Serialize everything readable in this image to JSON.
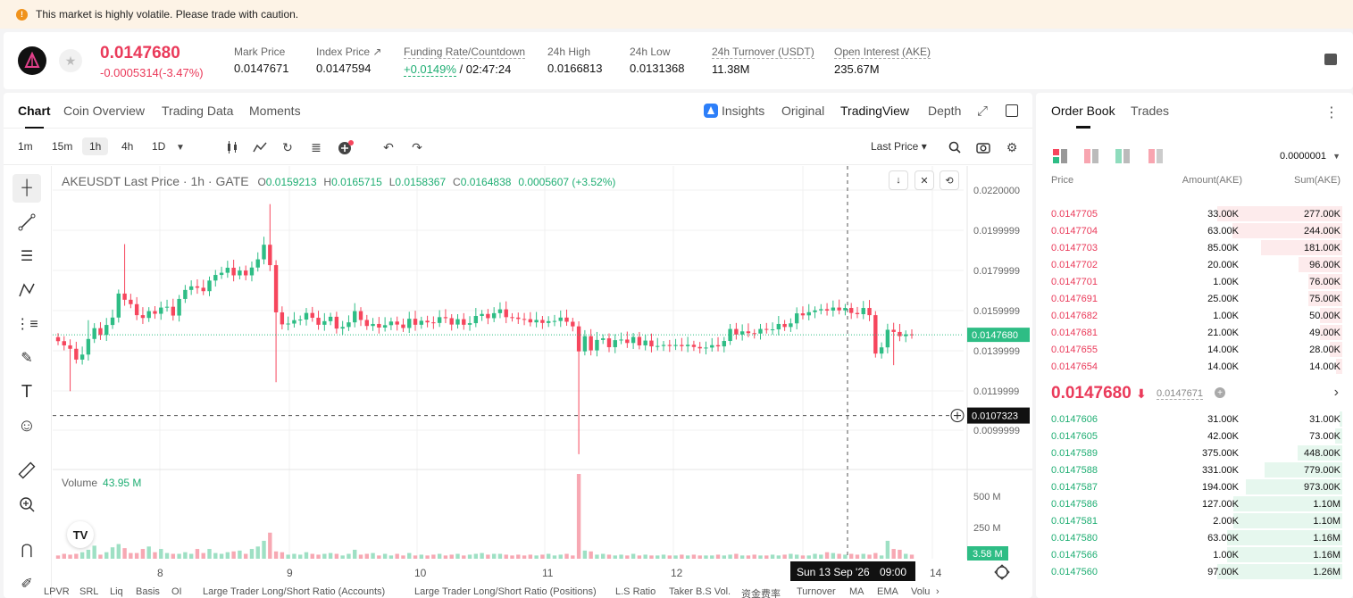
{
  "banner": {
    "text": "This market is highly volatile. Please trade with caution."
  },
  "ticker": {
    "last_price": "0.0147680",
    "change": "-0.0005314(-3.47%)",
    "stats": [
      {
        "label": "Mark Price",
        "value": "0.0147671"
      },
      {
        "label": "Index Price ↗",
        "value": "0.0147594"
      },
      {
        "label": "Funding Rate/Countdown",
        "value_rate": "+0.0149%",
        "value_countdown": " / 02:47:24"
      },
      {
        "label": "24h High",
        "value": "0.0166813"
      },
      {
        "label": "24h Low",
        "value": "0.0131368"
      },
      {
        "label": "24h Turnover (USDT)",
        "value": "11.38M"
      },
      {
        "label": "Open Interest (AKE)",
        "value": "235.67M"
      }
    ]
  },
  "tabs": [
    "Chart",
    "Coin Overview",
    "Trading Data",
    "Moments"
  ],
  "view_tabs": [
    "Insights",
    "Original",
    "TradingView",
    "Depth"
  ],
  "toolbar": {
    "intervals": [
      "1m",
      "15m",
      "1h",
      "4h",
      "1D"
    ],
    "price_type": "Last Price ▾"
  },
  "legend": {
    "symbol": "AKEUSDT Last Price · 1h · GATE",
    "open_label": "O",
    "open": "0.0159213",
    "high_label": "H",
    "high": "0.0165715",
    "low_label": "L",
    "low": "0.0158367",
    "close_label": "C",
    "close": "0.0164838",
    "change": "0.0005607 (+3.52%)"
  },
  "volume": {
    "label": "Volume",
    "value": "43.95 M"
  },
  "chart_data": {
    "type": "candlestick",
    "symbol": "AKEUSDT",
    "interval": "1h",
    "y_ticks": [
      "0.0220000",
      "0.0199999",
      "0.0179999",
      "0.0159999",
      "0.0139999",
      "0.0119999",
      "0.0099999"
    ],
    "vol_ticks": [
      "500 M",
      "250 M"
    ],
    "x_ticks": [
      "8",
      "9",
      "10",
      "11",
      "12",
      "14"
    ],
    "current_price": "0.0147680",
    "crosshair_price": "0.0107323",
    "current_volume": "3.58 M",
    "crosshair_time": "Sun 13 Sep '26",
    "crosshair_hour": "09:00",
    "closes": [
      0.01445,
      0.01424,
      0.01407,
      0.01353,
      0.01378,
      0.01456,
      0.0151,
      0.01476,
      0.01526,
      0.01563,
      0.01683,
      0.01652,
      0.0163,
      0.01575,
      0.01561,
      0.01595,
      0.01582,
      0.01613,
      0.01617,
      0.01573,
      0.01656,
      0.01701,
      0.01719,
      0.01712,
      0.01695,
      0.01748,
      0.01776,
      0.01787,
      0.01812,
      0.01774,
      0.01798,
      0.01774,
      0.01813,
      0.01854,
      0.01927,
      0.01825,
      0.01589,
      0.01529,
      0.01533,
      0.0155,
      0.01553,
      0.01586,
      0.01562,
      0.01527,
      0.01545,
      0.01567,
      0.01508,
      0.01516,
      0.01539,
      0.01595,
      0.01551,
      0.01521,
      0.01531,
      0.01513,
      0.01525,
      0.01543,
      0.01528,
      0.01511,
      0.01557,
      0.01527,
      0.01547,
      0.01539,
      0.01536,
      0.01565,
      0.0156,
      0.01528,
      0.01555,
      0.01527,
      0.01535,
      0.01571,
      0.01581,
      0.0156,
      0.01585,
      0.01604,
      0.01565,
      0.01563,
      0.01556,
      0.01555,
      0.01539,
      0.01551,
      0.01536,
      0.01545,
      0.01546,
      0.01563,
      0.01542,
      0.01519,
      0.01394,
      0.0147,
      0.01399,
      0.01451,
      0.01459,
      0.01415,
      0.0145,
      0.01453,
      0.01436,
      0.01466,
      0.01424,
      0.01448,
      0.01419,
      0.01421,
      0.01426,
      0.01421,
      0.01426,
      0.0142,
      0.01427,
      0.01416,
      0.01409,
      0.01413,
      0.01425,
      0.01419,
      0.01446,
      0.01506,
      0.01478,
      0.01494,
      0.01485,
      0.01483,
      0.01506,
      0.01503,
      0.01504,
      0.01531,
      0.01516,
      0.01534,
      0.01584,
      0.01574,
      0.0159,
      0.01599,
      0.01605,
      0.01598,
      0.01613,
      0.01599,
      0.01611,
      0.01586,
      0.0158,
      0.01611,
      0.01575,
      0.01383,
      0.01414,
      0.01502,
      0.01491,
      0.0147,
      0.01479,
      0.01477
    ],
    "volumes_m": [
      20,
      30,
      25,
      30,
      40,
      55,
      80,
      25,
      40,
      70,
      90,
      65,
      35,
      35,
      60,
      75,
      40,
      60,
      35,
      30,
      30,
      40,
      30,
      60,
      35,
      60,
      35,
      30,
      40,
      45,
      50,
      30,
      60,
      75,
      110,
      160,
      45,
      40,
      25,
      30,
      25,
      40,
      30,
      25,
      30,
      35,
      30,
      20,
      30,
      55,
      25,
      30,
      35,
      20,
      30,
      20,
      30,
      20,
      35,
      20,
      25,
      20,
      25,
      30,
      20,
      25,
      30,
      20,
      25,
      30,
      35,
      25,
      30,
      30,
      25,
      20,
      25,
      20,
      25,
      20,
      25,
      30,
      20,
      25,
      30,
      20,
      520,
      50,
      45,
      25,
      30,
      25,
      20,
      25,
      20,
      30,
      20,
      25,
      20,
      20,
      25,
      20,
      20,
      25,
      20,
      25,
      20,
      20,
      20,
      25,
      20,
      25,
      30,
      20,
      20,
      25,
      20,
      20,
      25,
      20,
      25,
      30,
      25,
      20,
      20,
      30,
      25,
      40,
      35,
      30,
      25,
      30,
      25,
      30,
      25,
      35,
      20,
      110,
      60,
      55,
      30,
      25,
      20,
      20
    ]
  },
  "bottom": [
    "LPVR",
    "SRL",
    "Liq",
    "Basis",
    "OI",
    "Large Trader Long/Short Ratio (Accounts)",
    "Large Trader Long/Short Ratio (Positions)",
    "L.S Ratio",
    "Taker B.S Vol.",
    "资金费率",
    "Turnover",
    "MA",
    "EMA",
    "Volu"
  ],
  "orderbook": {
    "tabs": [
      "Order Book",
      "Trades"
    ],
    "precision": "0.0000001",
    "headers": [
      "Price",
      "Amount(AKE)",
      "Sum(AKE)"
    ],
    "asks": [
      [
        "0.0147705",
        "33.00K",
        "277.00K"
      ],
      [
        "0.0147704",
        "63.00K",
        "244.00K"
      ],
      [
        "0.0147703",
        "85.00K",
        "181.00K"
      ],
      [
        "0.0147702",
        "20.00K",
        "96.00K"
      ],
      [
        "0.0147701",
        "1.00K",
        "76.00K"
      ],
      [
        "0.0147691",
        "25.00K",
        "75.00K"
      ],
      [
        "0.0147682",
        "1.00K",
        "50.00K"
      ],
      [
        "0.0147681",
        "21.00K",
        "49.00K"
      ],
      [
        "0.0147655",
        "14.00K",
        "28.00K"
      ],
      [
        "0.0147654",
        "14.00K",
        "14.00K"
      ]
    ],
    "mid_price": "0.0147680",
    "mid_arrow": "⬇",
    "mark_price": "0.0147671",
    "bids": [
      [
        "0.0147606",
        "31.00K",
        "31.00K"
      ],
      [
        "0.0147605",
        "42.00K",
        "73.00K"
      ],
      [
        "0.0147589",
        "375.00K",
        "448.00K"
      ],
      [
        "0.0147588",
        "331.00K",
        "779.00K"
      ],
      [
        "0.0147587",
        "194.00K",
        "973.00K"
      ],
      [
        "0.0147586",
        "127.00K",
        "1.10M"
      ],
      [
        "0.0147581",
        "2.00K",
        "1.10M"
      ],
      [
        "0.0147580",
        "63.00K",
        "1.16M"
      ],
      [
        "0.0147566",
        "1.00K",
        "1.16M"
      ],
      [
        "0.0147560",
        "97.00K",
        "1.26M"
      ]
    ],
    "ask_depth": [
      0.277,
      0.244,
      0.181,
      0.096,
      0.076,
      0.075,
      0.05,
      0.049,
      0.028,
      0.014
    ],
    "bid_depth": [
      0.031,
      0.073,
      0.448,
      0.779,
      0.973,
      1.1,
      1.1,
      1.16,
      1.16,
      1.26
    ]
  },
  "colors": {
    "up": "#2ebd85",
    "down": "#f6465d",
    "accent": "#1fae73"
  }
}
